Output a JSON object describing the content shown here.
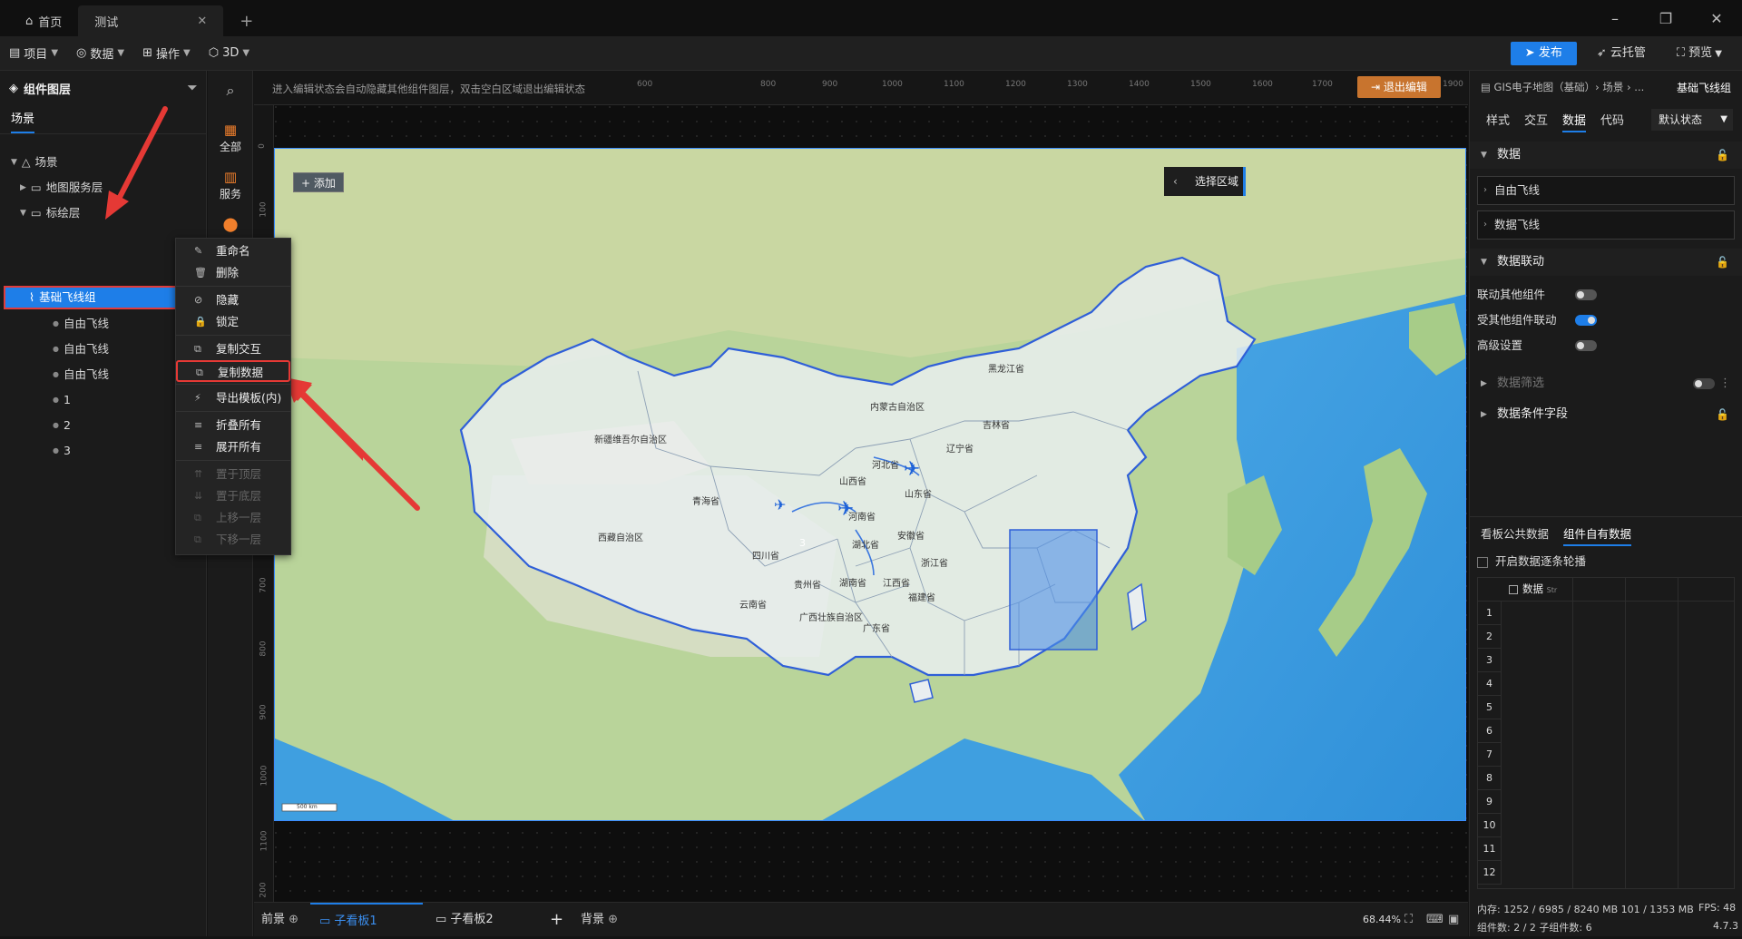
{
  "titlebar": {
    "tabs": [
      {
        "label": "首页",
        "icon": "home-icon"
      },
      {
        "label": "测试",
        "icon": ""
      }
    ],
    "add_tab": "+"
  },
  "menubar": {
    "items": [
      "项目",
      "数据",
      "操作",
      "3D"
    ],
    "publish": "发布",
    "cloud": "云托管",
    "preview": "预览"
  },
  "layers": {
    "title": "组件图层",
    "tab": "场景",
    "tree": [
      {
        "label": "场景",
        "level": 0
      },
      {
        "label": "地图服务层",
        "level": 1
      },
      {
        "label": "标绘层",
        "level": 1
      },
      {
        "label": "基础飞线组",
        "level": 2,
        "selected": true
      },
      {
        "label": "自由飞线",
        "level": 3
      },
      {
        "label": "自由飞线",
        "level": 3
      },
      {
        "label": "自由飞线",
        "level": 3
      },
      {
        "label": "1",
        "level": 3
      },
      {
        "label": "2",
        "level": 3
      },
      {
        "label": "3",
        "level": 3
      }
    ]
  },
  "rail": [
    "全部",
    "服务"
  ],
  "canvas": {
    "hint": "进入编辑状态会自动隐藏其他组件图层，双击空白区域退出编辑状态",
    "exit_edit": "退出编辑",
    "add_label": "添加",
    "select_area": "选择区域",
    "scale": "500 km",
    "ruler_top": [
      "600",
      "800",
      "900",
      "1000",
      "1100",
      "1200",
      "1300",
      "1400",
      "1500",
      "1600",
      "1700",
      "1900"
    ],
    "ruler_left": [
      "0",
      "100",
      "700",
      "800",
      "900",
      "1000",
      "1100",
      "200"
    ]
  },
  "map_labels": {
    "heilongjiang": "黑龙江省",
    "neimenggu": "内蒙古自治区",
    "jilin": "吉林省",
    "liaoning": "辽宁省",
    "hebei": "河北省",
    "shanxi": "山西省",
    "shandong": "山东省",
    "henan": "河南省",
    "anhui": "安徽省",
    "hubei": "湖北省",
    "zhejiang": "浙江省",
    "jiangxi": "江西省",
    "hunan": "湖南省",
    "fujian": "福建省",
    "guizhou": "贵州省",
    "guangxi": "广西壮族自治区",
    "guangdong": "广东省",
    "yunnan": "云南省",
    "sichuan": "四川省",
    "qinghai": "青海省",
    "xizang": "西藏自治区",
    "xinjiang": "新疆维吾尔自治区",
    "marker3": "3"
  },
  "context_menu": {
    "items": [
      {
        "label": "重命名",
        "icon": "pencil-icon",
        "disabled": false
      },
      {
        "label": "删除",
        "icon": "trash-icon",
        "disabled": false
      },
      {
        "label": "隐藏",
        "icon": "eye-off-icon",
        "disabled": false
      },
      {
        "label": "锁定",
        "icon": "lock-icon",
        "disabled": false
      },
      {
        "label": "复制交互",
        "icon": "copy-icon",
        "disabled": false
      },
      {
        "label": "复制数据",
        "icon": "copy-icon",
        "disabled": false
      },
      {
        "label": "导出模板(内)",
        "icon": "bolt-icon",
        "disabled": false
      },
      {
        "label": "折叠所有",
        "icon": "list-icon",
        "disabled": false
      },
      {
        "label": "展开所有",
        "icon": "list-icon",
        "disabled": false
      },
      {
        "label": "置于顶层",
        "icon": "to-top-icon",
        "disabled": true
      },
      {
        "label": "置于底层",
        "icon": "to-bottom-icon",
        "disabled": true
      },
      {
        "label": "上移一层",
        "icon": "move-up-icon",
        "disabled": true
      },
      {
        "label": "下移一层",
        "icon": "move-down-icon",
        "disabled": true
      }
    ]
  },
  "bottombar": {
    "front": "前景",
    "sub1": "子看板1",
    "sub2": "子看板2",
    "add": "+",
    "back": "背景",
    "zoom": "68.44%"
  },
  "right": {
    "breadcrumb": "GIS电子地图（基础）› 场景 › ...",
    "current": "基础飞线组",
    "tabs": [
      "样式",
      "交互",
      "数据",
      "代码"
    ],
    "state": "默认状态",
    "sec_data": "数据",
    "field1": "自由飞线",
    "field2": "数据飞线",
    "sec_link": "数据联动",
    "link_other": "联动其他组件",
    "linked_by": "受其他组件联动",
    "advanced": "高级设置",
    "filter": "数据筛选",
    "cond": "数据条件字段",
    "data_tabs": [
      "看板公共数据",
      "组件自有数据"
    ],
    "carousel": "开启数据逐条轮播",
    "col_header": "数据",
    "col_type": "Str",
    "rows": [
      "1",
      "2",
      "3",
      "4",
      "5",
      "6",
      "7",
      "8",
      "9",
      "10",
      "11",
      "12"
    ],
    "mem": "内存:  1252 / 6985 / 8240 MB  101 / 1353 MB",
    "fps": "FPS:  48",
    "counts": "组件数: 2 / 2    子组件数: 6",
    "version": "4.7.3"
  }
}
